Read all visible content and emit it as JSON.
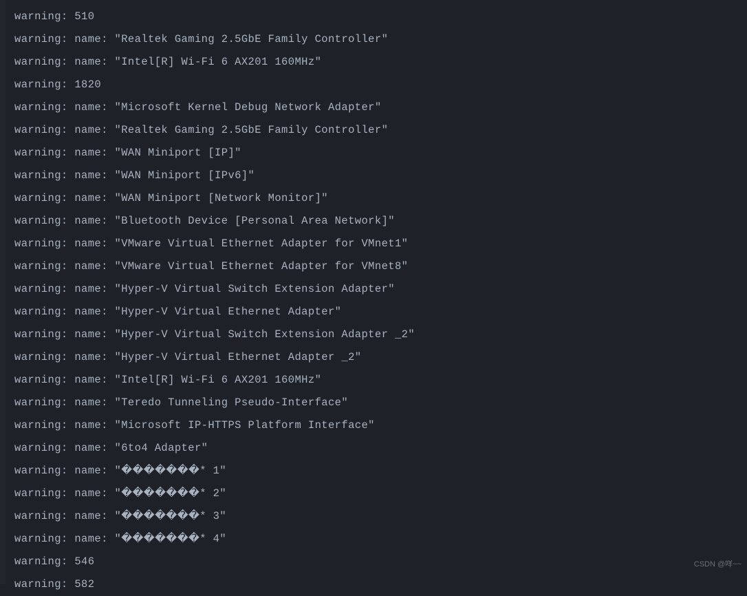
{
  "watermark": "CSDN @咩~~",
  "lines": [
    "warning: 510",
    "warning: name: \"Realtek Gaming 2.5GbE Family Controller\"",
    "warning: name: \"Intel[R] Wi-Fi 6 AX201 160MHz\"",
    "warning: 1820",
    "warning: name: \"Microsoft Kernel Debug Network Adapter\"",
    "warning: name: \"Realtek Gaming 2.5GbE Family Controller\"",
    "warning: name: \"WAN Miniport [IP]\"",
    "warning: name: \"WAN Miniport [IPv6]\"",
    "warning: name: \"WAN Miniport [Network Monitor]\"",
    "warning: name: \"Bluetooth Device [Personal Area Network]\"",
    "warning: name: \"VMware Virtual Ethernet Adapter for VMnet1\"",
    "warning: name: \"VMware Virtual Ethernet Adapter for VMnet8\"",
    "warning: name: \"Hyper-V Virtual Switch Extension Adapter\"",
    "warning: name: \"Hyper-V Virtual Ethernet Adapter\"",
    "warning: name: \"Hyper-V Virtual Switch Extension Adapter _2\"",
    "warning: name: \"Hyper-V Virtual Ethernet Adapter _2\"",
    "warning: name: \"Intel[R] Wi-Fi 6 AX201 160MHz\"",
    "warning: name: \"Teredo Tunneling Pseudo-Interface\"",
    "warning: name: \"Microsoft IP-HTTPS Platform Interface\"",
    "warning: name: \"6to4 Adapter\"",
    "warning: name: \"�������* 1\"",
    "warning: name: \"�������* 2\"",
    "warning: name: \"�������* 3\"",
    "warning: name: \"�������* 4\"",
    "warning: 546",
    "warning: 582"
  ]
}
